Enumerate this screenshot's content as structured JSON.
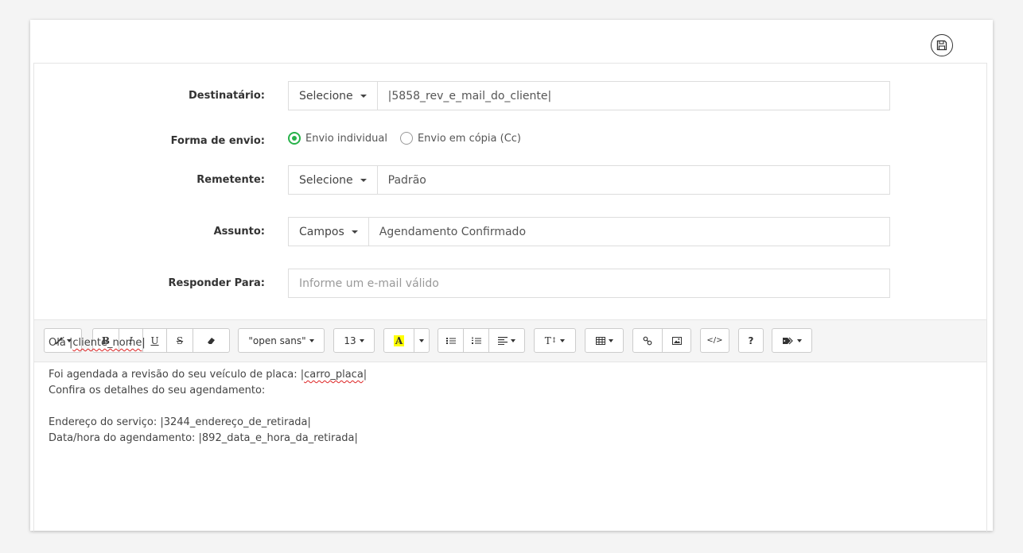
{
  "form": {
    "destinatario": {
      "label": "Destinatário:",
      "dropdown": "Selecione",
      "value": "|5858_rev_e_mail_do_cliente|"
    },
    "forma_envio": {
      "label": "Forma de envio:",
      "options": [
        "Envio individual",
        "Envio em cópia (Cc)"
      ],
      "selected": "Envio individual"
    },
    "remetente": {
      "label": "Remetente:",
      "dropdown": "Selecione",
      "value": "Padrão"
    },
    "assunto": {
      "label": "Assunto:",
      "dropdown": "Campos",
      "value": "Agendamento Confirmado"
    },
    "responder_para": {
      "label": "Responder Para:",
      "placeholder": "Informe um e-mail válido"
    }
  },
  "toolbar": {
    "bold": "B",
    "italic": "I",
    "underline": "U",
    "strikethrough": "S",
    "font_family": "\"open sans\"",
    "font_size": "13",
    "highlight": "A",
    "text_format": "T",
    "help": "?"
  },
  "editor": {
    "greeting_prefix": "Olá |",
    "greeting_field": "cliente_nome",
    "greeting_suffix": "|",
    "line1_prefix": "Foi agendada a revisão do seu veículo de placa: |",
    "line1_field": "carro_placa",
    "line1_suffix": "|",
    "line2": "Confira os detalhes do seu agendamento:",
    "line3": "Endereço do serviço: |3244_endereço_de_retirada|",
    "line4": "Data/hora do agendamento: |892_data_e_hora_da_retirada|"
  },
  "colors": {
    "radio_active": "#27b24a",
    "highlight_yellow": "#ffff00"
  },
  "icons": [
    "save-icon",
    "magic-wand-icon",
    "eraser-icon",
    "unordered-list-icon",
    "ordered-list-icon",
    "align-icon",
    "table-icon",
    "link-icon",
    "image-icon",
    "code-view-icon",
    "tag-icon"
  ]
}
